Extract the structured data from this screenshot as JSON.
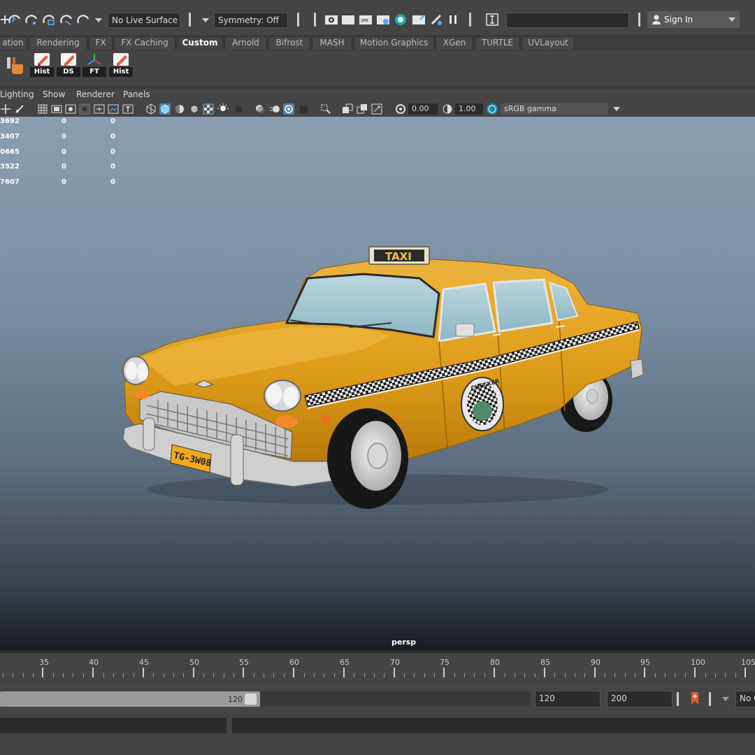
{
  "status_line": {
    "live_surface": "No Live Surface",
    "symmetry": "Symmetry: Off",
    "sign_in": "Sign In",
    "ipr_label": "IPR"
  },
  "shelf": {
    "tabs": [
      {
        "label": "ation",
        "active": false
      },
      {
        "label": "Rendering",
        "active": false
      },
      {
        "label": "FX",
        "active": false
      },
      {
        "label": "FX Caching",
        "active": false
      },
      {
        "label": "Custom",
        "active": true
      },
      {
        "label": "Arnold",
        "active": false
      },
      {
        "label": "Bifrost",
        "active": false
      },
      {
        "label": "MASH",
        "active": false
      },
      {
        "label": "Motion Graphics",
        "active": false
      },
      {
        "label": "XGen",
        "active": false
      },
      {
        "label": "TURTLE",
        "active": false
      },
      {
        "label": "UVLayout",
        "active": false
      }
    ],
    "buttons": [
      "Hist",
      "DS",
      "FT",
      "Hist"
    ]
  },
  "panel_menu": [
    "Lighting",
    "Show",
    "Renderer",
    "Panels"
  ],
  "panel_toolbar": {
    "exposure": "0.00",
    "gamma": "1.00",
    "color_space": "sRGB gamma"
  },
  "hud": {
    "rows": [
      {
        "value": "3692",
        "a": "0",
        "b": "0"
      },
      {
        "value": "3407",
        "a": "0",
        "b": "0"
      },
      {
        "value": "0665",
        "a": "0",
        "b": "0"
      },
      {
        "value": "3522",
        "a": "0",
        "b": "0"
      },
      {
        "value": "7607",
        "a": "0",
        "b": "0"
      }
    ]
  },
  "viewport": {
    "camera": "persp",
    "taxi_sign": "TAXI",
    "license_plate": "TG-3W08",
    "door_emblem": "CHECKER"
  },
  "time_slider": {
    "frames": [
      "35",
      "40",
      "45",
      "50",
      "55",
      "60",
      "65",
      "70",
      "75",
      "80",
      "85",
      "90",
      "95",
      "100",
      "105"
    ]
  },
  "range_slider": {
    "range_end": "120",
    "end_time": "120",
    "anim_end": "200",
    "char_set": "No C"
  },
  "colors": {
    "accent_blue": "#5285a6",
    "taxi_yellow": "#e3a21a",
    "viewport_top": "#8b9eb1",
    "viewport_bottom": "#181b22"
  }
}
